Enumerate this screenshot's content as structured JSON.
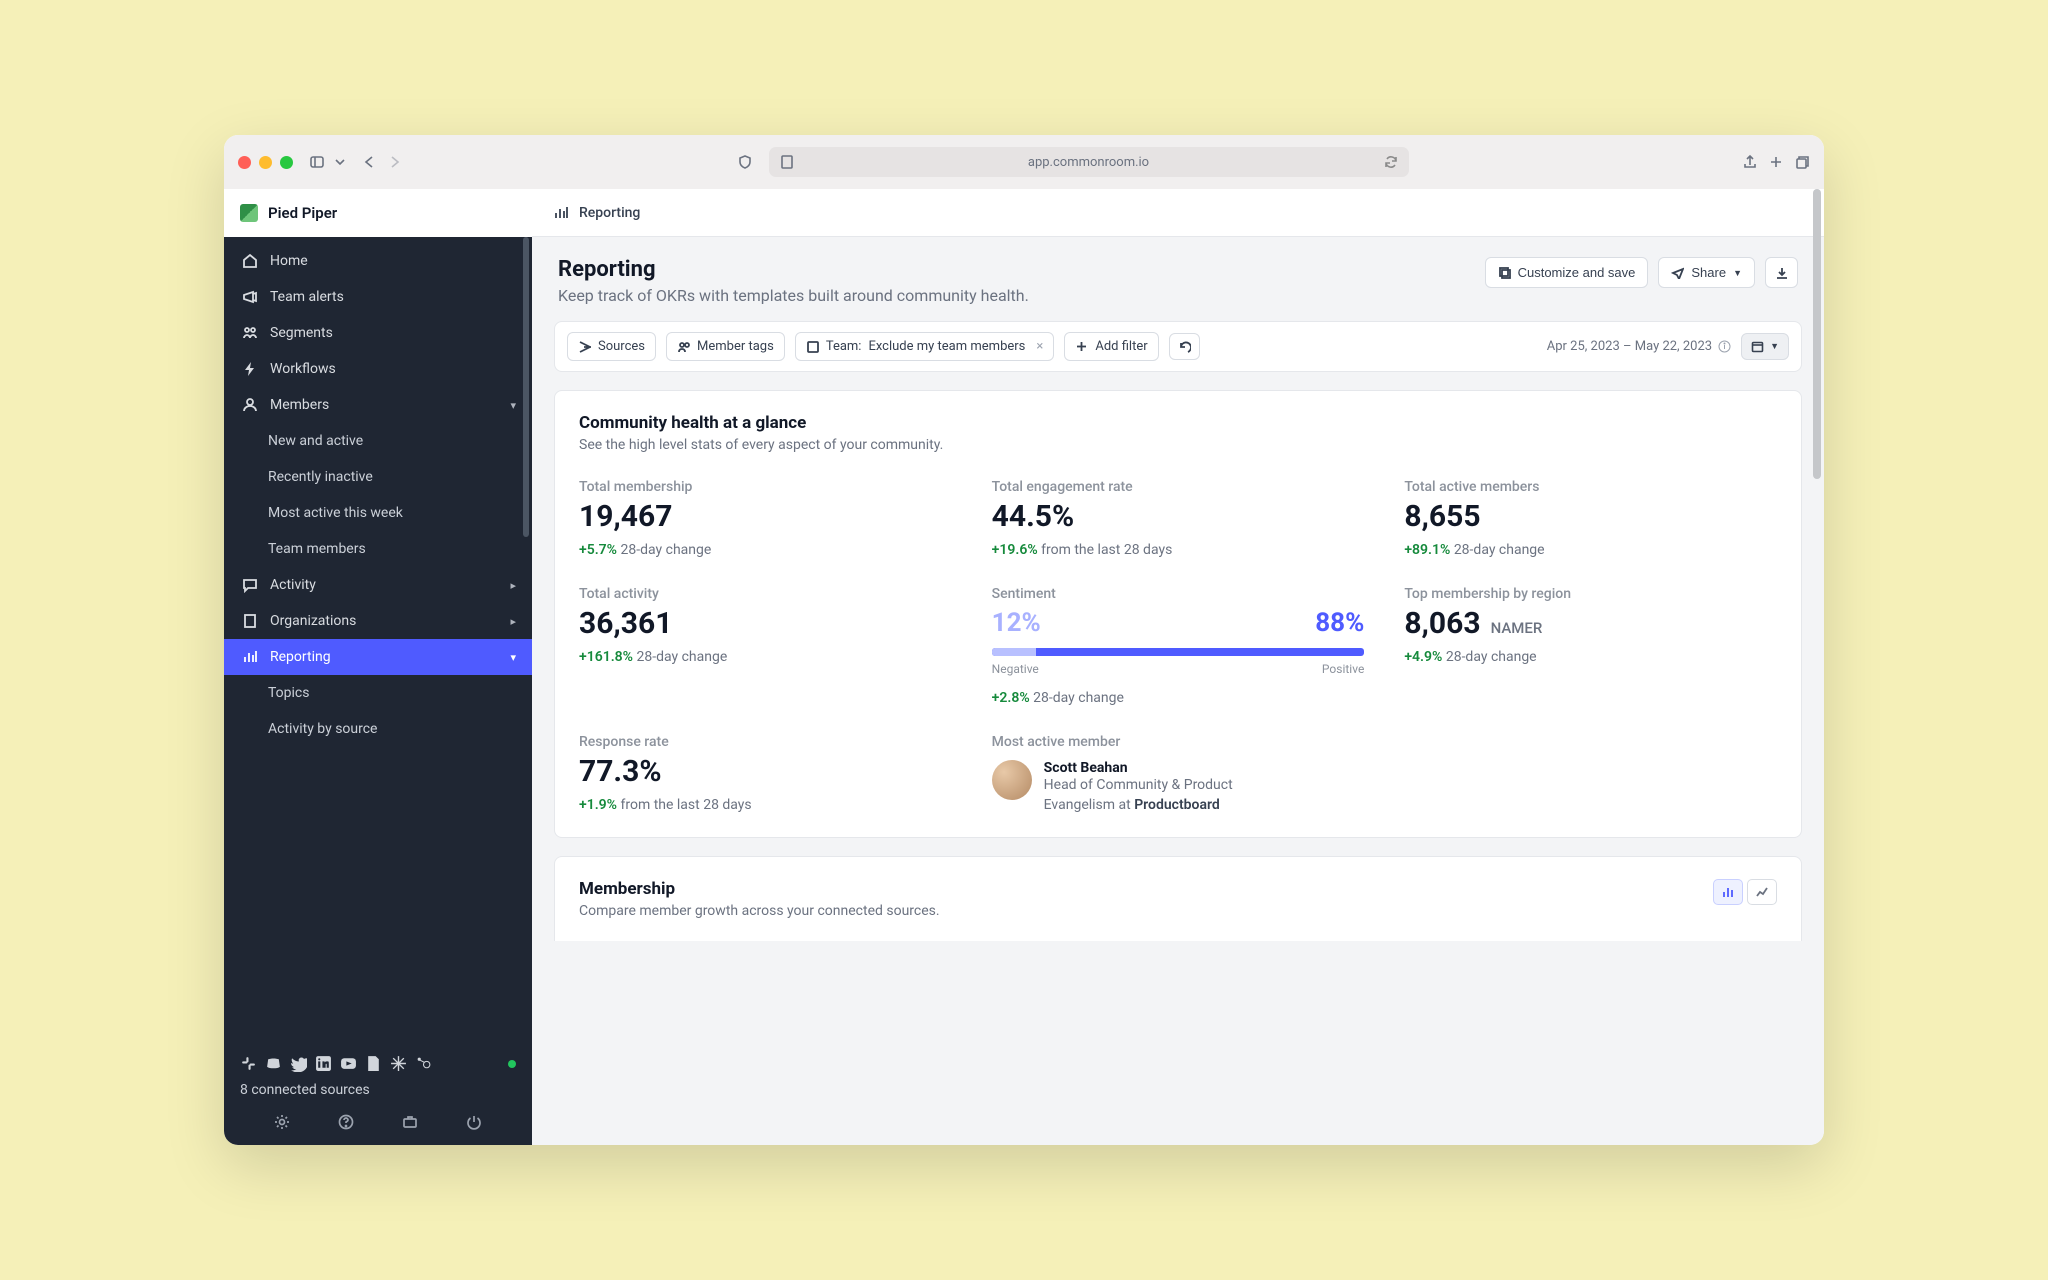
{
  "browser": {
    "url": "app.commonroom.io"
  },
  "workspace": "Pied Piper",
  "crumb": "Reporting",
  "sidebar": {
    "home": "Home",
    "alerts": "Team alerts",
    "segments": "Segments",
    "workflows": "Workflows",
    "members": "Members",
    "members_new": "New and active",
    "members_inactive": "Recently inactive",
    "members_mostactive": "Most active this week",
    "members_team": "Team members",
    "activity": "Activity",
    "orgs": "Organizations",
    "reporting": "Reporting",
    "topics": "Topics",
    "act_by_source": "Activity by source",
    "sources_count": "8 connected sources"
  },
  "hero": {
    "title": "Reporting",
    "subtitle": "Keep track of OKRs with templates built around community health.",
    "customize": "Customize and save",
    "share": "Share"
  },
  "filters": {
    "sources": "Sources",
    "member_tags": "Member tags",
    "team_label": "Team:",
    "team_value": "Exclude my team members",
    "add_filter": "Add filter",
    "date_range": "Apr 25, 2023 – May 22, 2023"
  },
  "panel1": {
    "title": "Community health at a glance",
    "subtitle": "See the high level stats of every aspect of your community.",
    "stats": {
      "total_membership": {
        "label": "Total membership",
        "value": "19,467",
        "change": "+5.7%",
        "suffix": "28-day change"
      },
      "engagement": {
        "label": "Total engagement rate",
        "value": "44.5%",
        "change": "+19.6%",
        "suffix": "from the last 28 days"
      },
      "active_members": {
        "label": "Total active members",
        "value": "8,655",
        "change": "+89.1%",
        "suffix": "28-day change"
      },
      "activity": {
        "label": "Total activity",
        "value": "36,361",
        "change": "+161.8%",
        "suffix": "28-day change"
      },
      "sentiment": {
        "label": "Sentiment",
        "neg": "12%",
        "pos": "88%",
        "neg_label": "Negative",
        "pos_label": "Positive",
        "change": "+2.8%",
        "suffix": "28-day change"
      },
      "region": {
        "label": "Top membership by region",
        "value": "8,063",
        "region": "NAMER",
        "change": "+4.9%",
        "suffix": "28-day change"
      },
      "response": {
        "label": "Response rate",
        "value": "77.3%",
        "change": "+1.9%",
        "suffix": "from the last 28 days"
      },
      "most_active": {
        "label": "Most active member",
        "name": "Scott Beahan",
        "role_pre": "Head of Community & Product Evangelism at ",
        "role_company": "Productboard"
      }
    }
  },
  "panel2": {
    "title": "Membership",
    "subtitle": "Compare member growth across your connected sources."
  }
}
